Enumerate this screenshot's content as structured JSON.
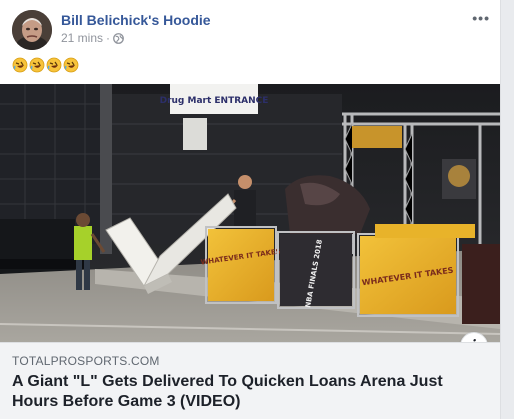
{
  "post": {
    "author": "Bill Belichick's Hoodie",
    "timestamp": "21 mins",
    "separator": "·",
    "privacy_icon": "globe-icon",
    "more_icon": "more-options-icon",
    "text_emojis": [
      "🤣",
      "🤣",
      "🤣",
      "🤣"
    ]
  },
  "image": {
    "sign_entrance": "Drug Mart ENTRANCE",
    "banners": [
      {
        "label": "WHATEVER IT TAKES"
      },
      {
        "label": "NBA FINALS 2018"
      },
      {
        "label": "WHATEVER IT TAKES"
      }
    ]
  },
  "link": {
    "domain": "TOTALPROSPORTS.COM",
    "title": "A Giant \"L\" Gets Delivered To Quicken Loans Arena Just Hours Before Game 3 (VIDEO)",
    "info_icon_label": "i"
  },
  "colors": {
    "link_blue": "#365899",
    "meta_gray": "#90949c",
    "banner_gold": "#e8b32a",
    "banner_dark": "#2e2c31"
  }
}
